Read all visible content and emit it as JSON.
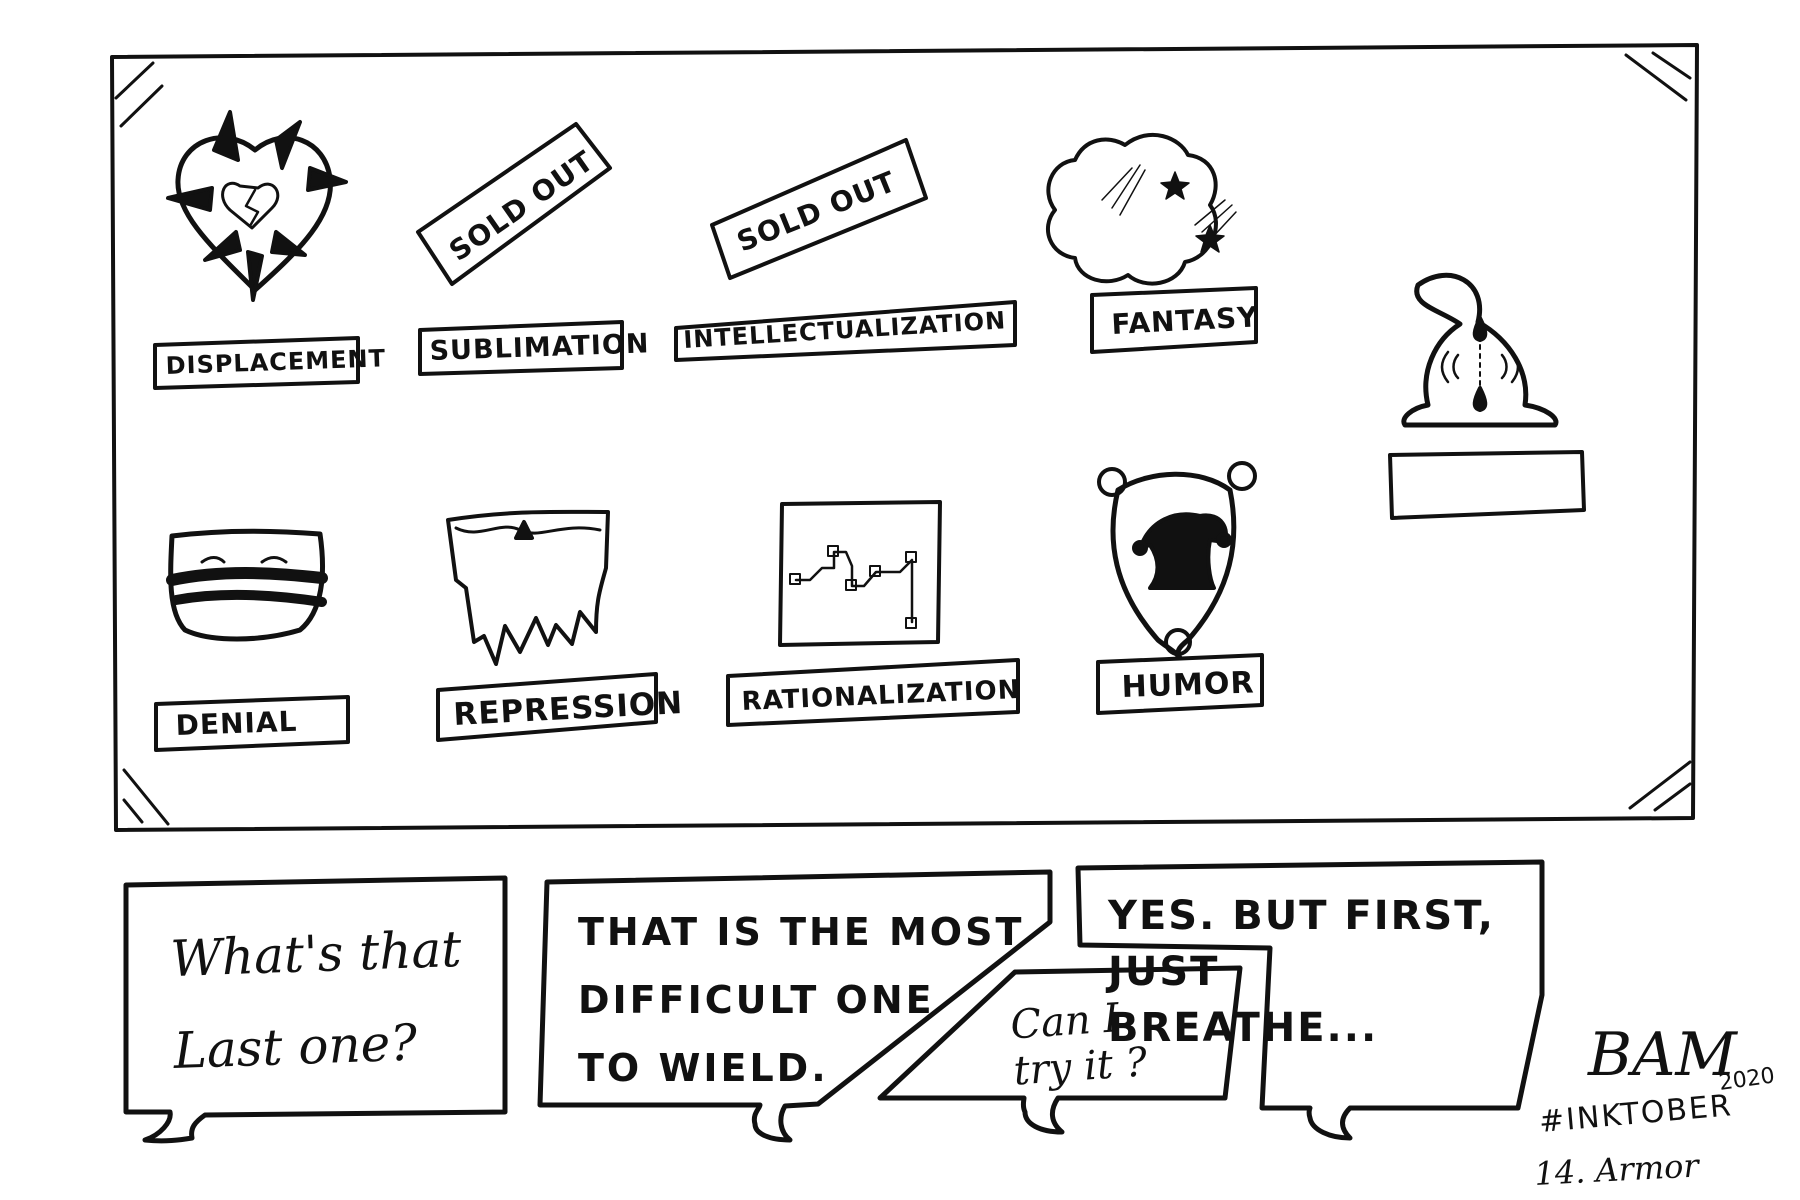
{
  "shelf": {
    "labels": {
      "displacement": "DISPLACEMENT",
      "sublimation": "SUBLIMATION",
      "intellectualization": "INTELLECTUALIZATION",
      "fantasy": "FANTASY",
      "denial": "DENIAL",
      "repression": "REPRESSION",
      "rationalization": "RATIONALIZATION",
      "humor": "HUMOR",
      "last": ""
    },
    "sold_out_1": "SOLD OUT",
    "sold_out_2": "SOLD OUT"
  },
  "bubbles": {
    "b1": "What's that\nLast one?",
    "b2": "THAT IS THE MOST\nDIFFICULT ONE\nTO WIELD.",
    "b3": "Can I\ntry it ?",
    "b4": "YES.  BUT FIRST,\nJUST\nBREATHE..."
  },
  "signature": {
    "initials": "BAM",
    "year": "2020",
    "hashtag": "#INKTOBER",
    "prompt": "14. Armor"
  }
}
